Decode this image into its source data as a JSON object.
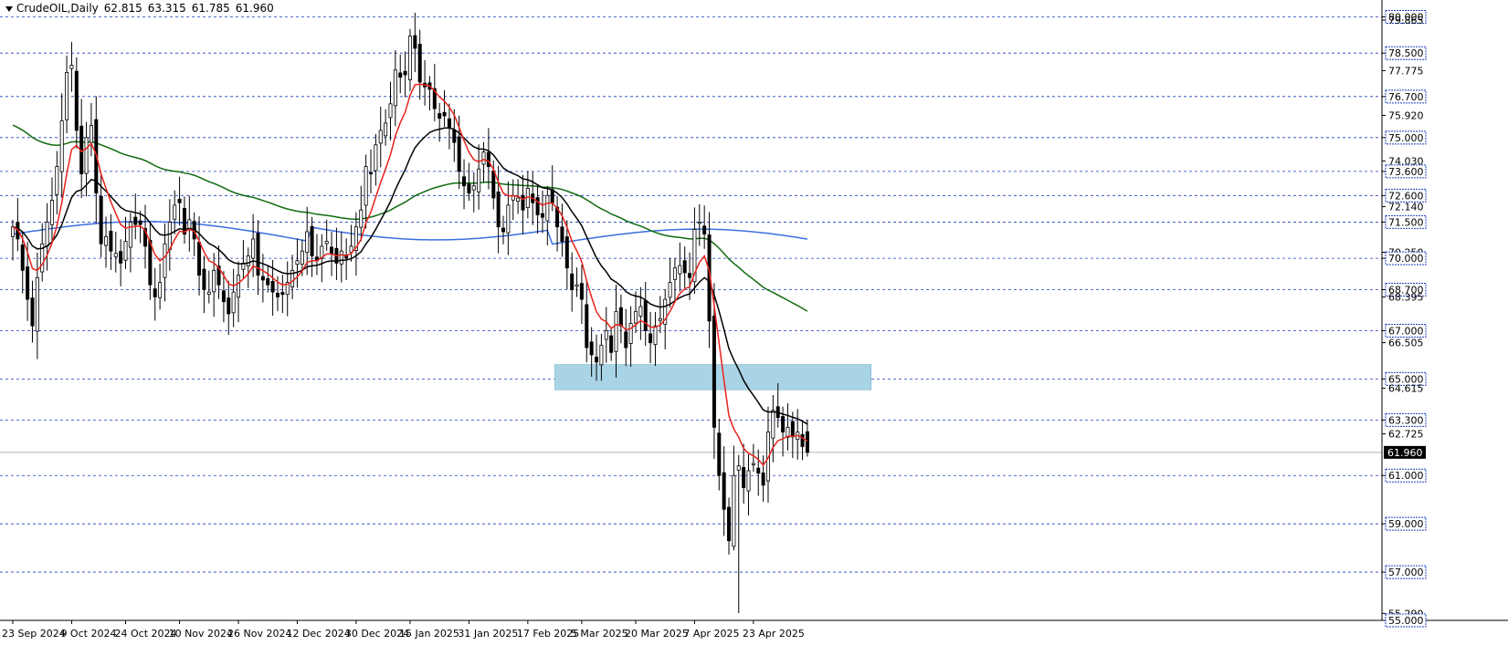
{
  "header": {
    "symbol": "CrudeOIL,Daily",
    "open": "62.815",
    "high": "63.315",
    "low": "61.785",
    "close": "61.960"
  },
  "colors": {
    "background": "#ffffff",
    "grid": "#1f3fbf",
    "ma_fast": "#e8231c",
    "ma_mid": "#000000",
    "ma_slow": "#0f6b0f",
    "ma_long": "#3b6fe0",
    "zone": "#a9d4e6",
    "current_price_line": "#b0b0b0",
    "candle_up_fill": "#ffffff",
    "candle_down_fill": "#000000"
  },
  "chart_data": {
    "type": "candlestick",
    "symbol": "CrudeOIL",
    "timeframe": "Daily",
    "ylim": [
      55.0,
      80.7
    ],
    "price_labels": [
      "80.000",
      "79.865",
      "78.500",
      "77.775",
      "76.700",
      "75.920",
      "75.000",
      "74.030",
      "73.600",
      "72.600",
      "72.140",
      "71.500",
      "70.250",
      "70.000",
      "68.700",
      "68.395",
      "67.000",
      "66.505",
      "65.000",
      "64.615",
      "63.300",
      "62.725",
      "61.960",
      "61.000",
      "59.000",
      "57.000",
      "55.290",
      "55.000"
    ],
    "grid_levels": [
      80.0,
      78.5,
      76.7,
      75.0,
      73.6,
      72.6,
      71.5,
      70.0,
      68.7,
      67.0,
      65.0,
      63.3,
      61.0,
      59.0,
      57.0,
      55.0
    ],
    "boxed_levels": [
      80.0,
      78.5,
      76.7,
      75.0,
      73.6,
      72.6,
      71.5,
      70.0,
      68.7,
      67.0,
      65.0,
      63.3,
      61.0,
      59.0,
      57.0,
      55.0
    ],
    "current_price": 61.96,
    "x_labels": [
      {
        "date": "23 Sep 2024",
        "index": 0
      },
      {
        "date": "9 Oct 2024",
        "index": 12
      },
      {
        "date": "24 Oct 2024",
        "index": 23
      },
      {
        "date": "10 Nov 2024",
        "index": 34
      },
      {
        "date": "26 Nov 2024",
        "index": 46
      },
      {
        "date": "12 Dec 2024",
        "index": 58
      },
      {
        "date": "30 Dec 2024",
        "index": 70
      },
      {
        "date": "15 Jan 2025",
        "index": 81
      },
      {
        "date": "31 Jan 2025",
        "index": 93
      },
      {
        "date": "17 Feb 2025",
        "index": 105
      },
      {
        "date": "5 Mar 2025",
        "index": 116
      },
      {
        "date": "20 Mar 2025",
        "index": 127
      },
      {
        "date": "7 Apr 2025",
        "index": 139
      },
      {
        "date": "23 Apr 2025",
        "index": 151
      }
    ],
    "zone": {
      "from_index": 112,
      "to_index": 175,
      "low": 64.55,
      "high": 65.6
    },
    "close": [
      71.3,
      70.8,
      69.5,
      68.3,
      67.2,
      69.2,
      70.6,
      71.5,
      72.4,
      73.8,
      75.7,
      77.7,
      78.0,
      75.3,
      73.5,
      75.0,
      75.5,
      72.7,
      70.6,
      70.9,
      70.3,
      70.2,
      69.8,
      70.7,
      71.5,
      71.4,
      71.4,
      70.5,
      68.9,
      68.4,
      69.0,
      70.6,
      71.5,
      72.2,
      72.3,
      71.0,
      71.6,
      70.8,
      69.3,
      68.7,
      68.6,
      69.5,
      68.9,
      68.2,
      67.7,
      68.6,
      69.3,
      69.8,
      70.1,
      70.8,
      69.3,
      69.1,
      68.9,
      68.6,
      68.4,
      68.5,
      69.0,
      69.5,
      69.9,
      70.3,
      71.1,
      70.1,
      69.9,
      70.5,
      70.7,
      70.2,
      69.8,
      70.3,
      70.0,
      70.5,
      71.3,
      72.0,
      73.8,
      73.5,
      74.7,
      75.3,
      75.6,
      76.4,
      77.8,
      77.5,
      77.6,
      79.2,
      78.7,
      77.3,
      77.1,
      77.0,
      76.2,
      75.8,
      75.9,
      75.4,
      74.8,
      73.6,
      73.0,
      72.7,
      73.0,
      73.7,
      74.4,
      73.8,
      72.5,
      71.3,
      71.1,
      72.2,
      72.6,
      72.5,
      72.0,
      72.9,
      72.3,
      71.8,
      71.7,
      72.6,
      72.3,
      71.3,
      70.7,
      69.6,
      68.7,
      68.9,
      68.3,
      66.3,
      66.0,
      65.7,
      66.4,
      67.0,
      66.1,
      67.8,
      67.2,
      66.3,
      67.3,
      67.8,
      68.0,
      67.0,
      66.5,
      67.2,
      67.5,
      68.3,
      69.0,
      69.6,
      69.7,
      69.4,
      69.2,
      71.2,
      71.5,
      71.0,
      67.4,
      63.0,
      61.0,
      59.6,
      58.3,
      61.0,
      61.4,
      60.5,
      61.2,
      61.5,
      61.1,
      60.6,
      62.8,
      63.7,
      63.4,
      62.8,
      63.0,
      62.6,
      62.8,
      62.2,
      61.96
    ],
    "series": [
      {
        "name": "",
        "period": 8,
        "color": "#e8231c"
      },
      {
        "name": "",
        "period": 21,
        "color": "#000000"
      },
      {
        "name": "",
        "period": 100,
        "color": "#0f6b0f"
      },
      {
        "name": "",
        "period": 200,
        "color": "#3b6fe0"
      }
    ],
    "ma_long_start": 71.0,
    "ma_long_end": 70.55,
    "ma_slow_start": 75.6,
    "ma_slow_end": 68.4
  }
}
